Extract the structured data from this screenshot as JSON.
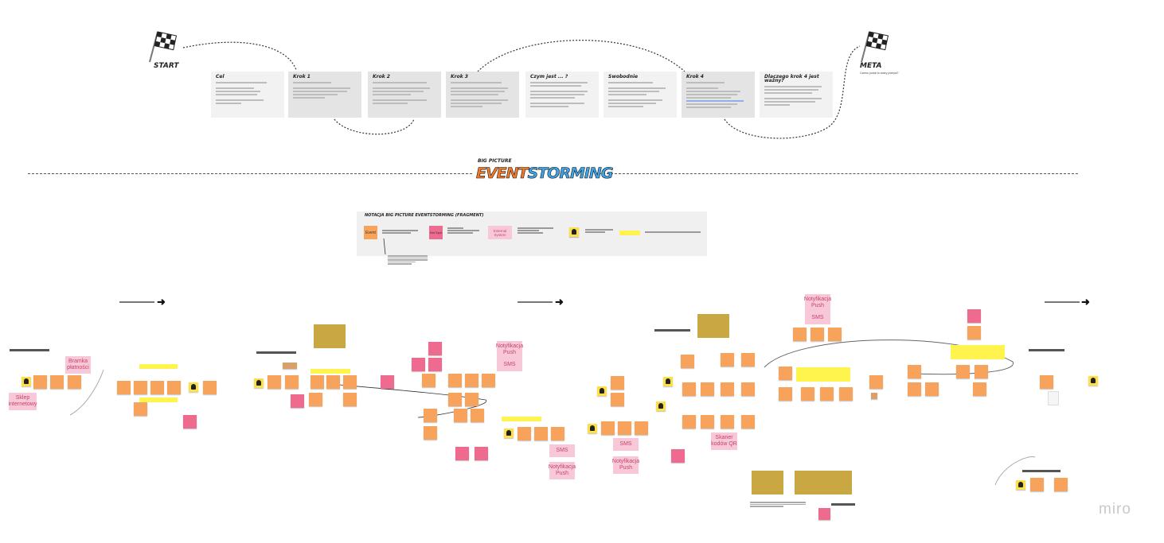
{
  "header": {
    "start_label": "START",
    "meta_label": "META",
    "meta_subtitle": "Czemu portal to dobry pomysł?",
    "cards": [
      {
        "title": "Cel",
        "dark": false
      },
      {
        "title": "Krok 1",
        "dark": true
      },
      {
        "title": "Krok 2",
        "dark": true
      },
      {
        "title": "Krok 3",
        "dark": true
      },
      {
        "title": "Czym jest ... ?",
        "dark": false
      },
      {
        "title": "Swobodnie",
        "dark": false
      },
      {
        "title": "Krok 4",
        "dark": true
      },
      {
        "title": "Dlaczego krok 4 jest ważny?",
        "dark": false
      }
    ]
  },
  "logo": {
    "small": "BIG PICTURE",
    "word1": "EVENT",
    "word2": "STORMING"
  },
  "legend": {
    "title": "NOTACJA BIG PICTURE EVENTSTORMING (FRAGMENT)",
    "event": "Event",
    "hotspot": "Hot Spot",
    "external": "External System"
  },
  "board": {
    "pink_notes": {
      "bramka": "Bramka płatności",
      "sklep": "Sklep internetowy",
      "notyfikacja": "Notyfikacja Push",
      "sms": "SMS",
      "skaner": "Skaner kodów QR"
    }
  },
  "brand": {
    "name": "miro"
  },
  "colors": {
    "event": "#f7a35c",
    "hotspot": "#ee6b8f",
    "external": "#f9c8d8",
    "actor": "#fde047",
    "highlight": "#fff34d"
  }
}
